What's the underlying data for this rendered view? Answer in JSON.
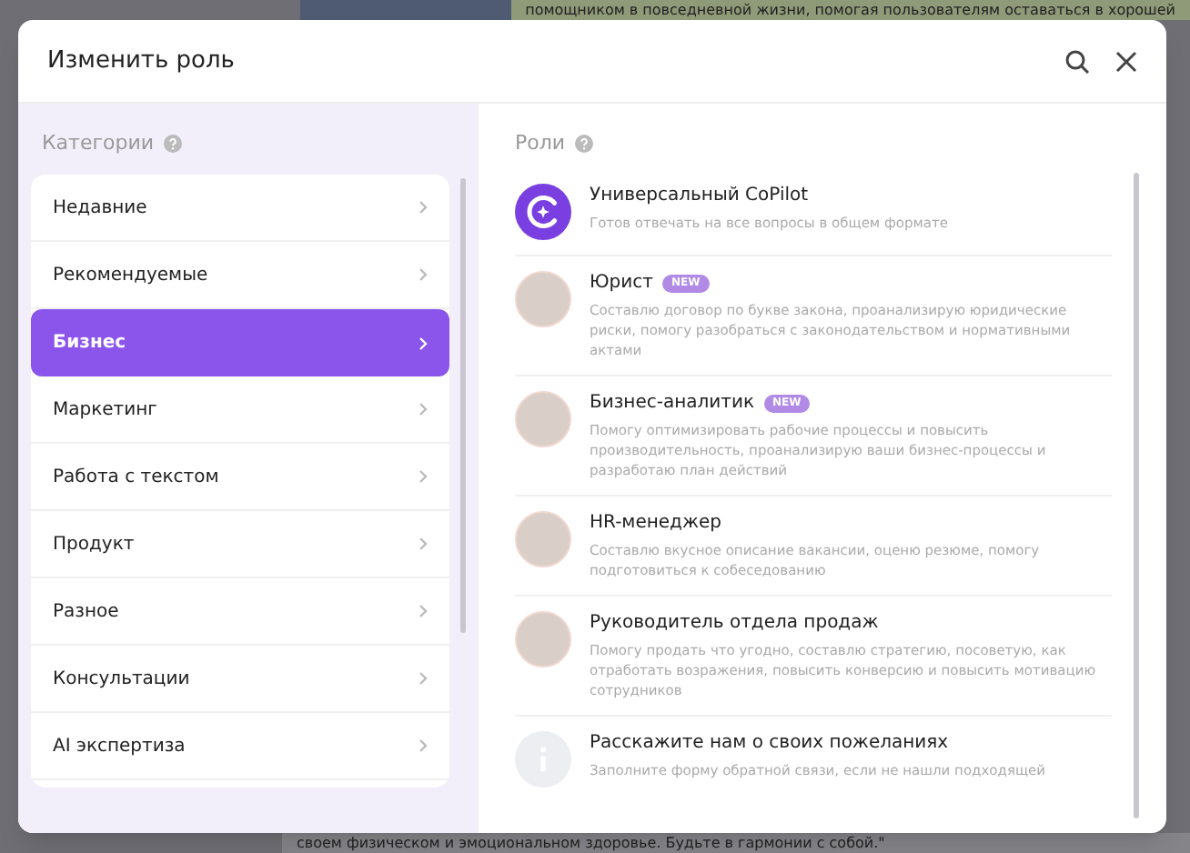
{
  "background": {
    "top_text": "помощником в повседневной жизни, помогая пользователям оставаться в хорошей",
    "bottom_text": "своем физическом и эмоциональном здоровье. Будьте в гармонии с собой.\""
  },
  "dialog": {
    "title": "Изменить роль"
  },
  "categories": {
    "heading": "Категории",
    "items": [
      {
        "label": "Недавние",
        "selected": false
      },
      {
        "label": "Рекомендуемые",
        "selected": false
      },
      {
        "label": "Бизнес",
        "selected": true
      },
      {
        "label": "Маркетинг",
        "selected": false
      },
      {
        "label": "Работа с текстом",
        "selected": false
      },
      {
        "label": "Продукт",
        "selected": false
      },
      {
        "label": "Разное",
        "selected": false
      },
      {
        "label": "Консультации",
        "selected": false
      },
      {
        "label": "AI экспертиза",
        "selected": false
      }
    ]
  },
  "roles": {
    "heading": "Роли",
    "items": [
      {
        "kind": "copilot",
        "name": "Универсальный CoPilot",
        "description": "Готов отвечать на все вопросы в общем формате"
      },
      {
        "kind": "photo",
        "name": "Юрист",
        "badge": "NEW",
        "description": "Составлю договор по букве закона, проанализирую юридические риски, помогу разобраться с законодательством и нормативными актами"
      },
      {
        "kind": "photo",
        "name": "Бизнес-аналитик",
        "badge": "NEW",
        "description": "Помогу оптимизировать рабочие процессы и повысить производительность, проанализирую ваши бизнес-процессы и разработаю план действий"
      },
      {
        "kind": "photo",
        "name": "HR-менеджер",
        "description": "Составлю вкусное описание вакансии, оценю резюме, помогу подготовиться к собеседованию"
      },
      {
        "kind": "photo",
        "name": "Руководитель отдела продаж",
        "description": "Помогу продать что угодно, составлю стратегию, посоветую, как отработать возражения, повысить конверсию и повысить мотивацию сотрудников"
      },
      {
        "kind": "info",
        "name": "Расскажите нам о своих пожеланиях",
        "description": "Заполните форму обратной связи, если не нашли подходящей"
      }
    ]
  }
}
